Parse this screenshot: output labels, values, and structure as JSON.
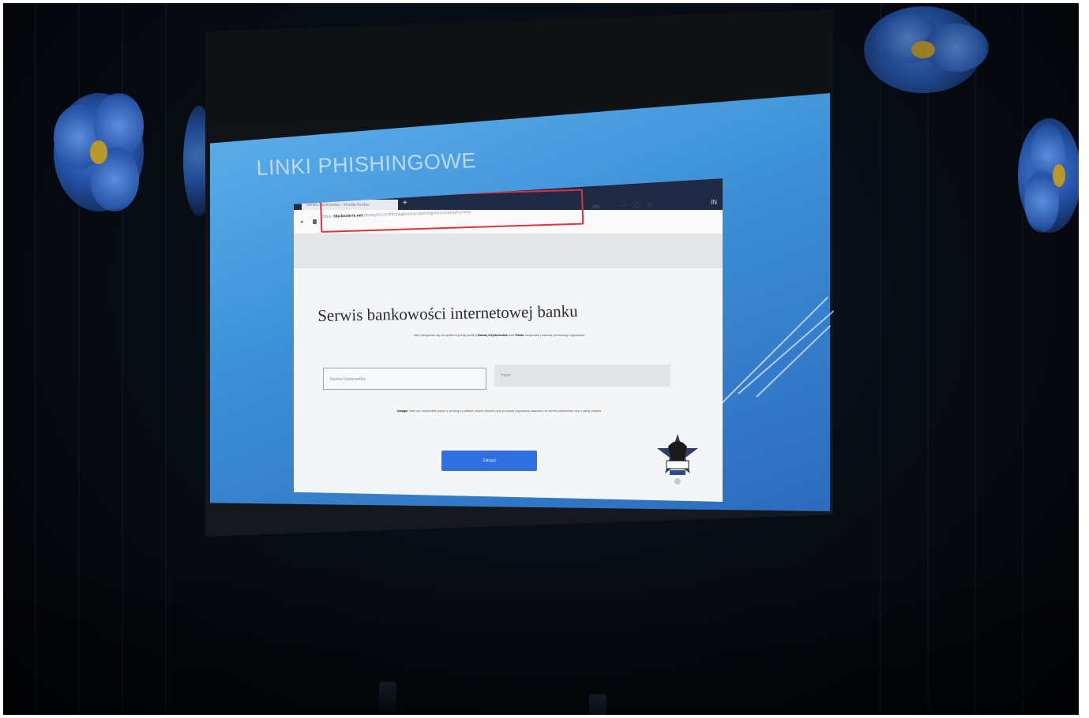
{
  "slide": {
    "title": "LINKI PHISHINGOWE"
  },
  "browser": {
    "tab_label": "Serwis bankowości - Mozilla Firefox",
    "new_tab": "+",
    "url_prefix": "https://",
    "url_domain": "libcbsvle-ls.net",
    "url_path": "/clibrary/FG2C8/ftrs/jegfvc/ohj/ralla/loSignOnContentyPa?SHy",
    "zoom": "90%",
    "toolbar_icons": "⋯ ⎕ ☆",
    "extension_icon": "IN"
  },
  "page": {
    "heading": "Serwis bankowości internetowej banku",
    "description_before": "Aby zalogować się do systemu podaj poniżej",
    "description_user_bold": "Nazwę Użytkownika",
    "description_and": "oraz",
    "description_pass_bold": "Hasło",
    "description_after": "otrzymane podczas pierwszego logowania",
    "user_placeholder": "Nazwa Użytkownika",
    "pass_placeholder": "Hasło",
    "warning_bold": "Uwaga!",
    "warning_text": "Jeśli nie otrzymałeś pisma z prosbą o podanie innych danych przy procesie logowania zadzwoń na numer",
    "warning_text2": "potwierdzić czy o takiej prosbie",
    "login_button": "Zaloguj"
  },
  "colors": {
    "slide_blue": "#3d8fd6",
    "url_highlight": "#d8343c",
    "login_button": "#2f6fe0",
    "flower_blue": "#2a5fc0"
  },
  "icons": {
    "back": "back-icon",
    "lock": "lock-icon",
    "police_emblem": "police-emblem-icon"
  }
}
